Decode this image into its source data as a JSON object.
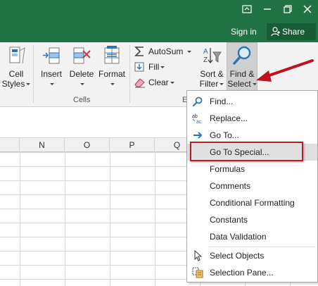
{
  "tabbar": {
    "signin": "Sign in",
    "share": "Share"
  },
  "ribbon": {
    "cell_styles": "Cell\nStyles",
    "insert": "Insert",
    "delete": "Delete",
    "format": "Format",
    "cells_group": "Cells",
    "autosum": "AutoSum",
    "fill": "Fill",
    "clear": "Clear",
    "editing_group_partial": "E",
    "sort_filter": "Sort &\nFilter",
    "find_select": "Find &\nSelect"
  },
  "columns": [
    "N",
    "O",
    "P",
    "Q"
  ],
  "menu": {
    "items": [
      {
        "label": "Find..."
      },
      {
        "label": "Replace..."
      },
      {
        "label": "Go To..."
      },
      {
        "label": "Go To Special..."
      },
      {
        "label": "Formulas"
      },
      {
        "label": "Comments"
      },
      {
        "label": "Conditional Formatting"
      },
      {
        "label": "Constants"
      },
      {
        "label": "Data Validation"
      },
      {
        "label": "Select Objects"
      },
      {
        "label": "Selection Pane..."
      }
    ]
  },
  "colors": {
    "brand": "#217346",
    "brand_dark": "#185c37",
    "highlight_box": "#b3202a"
  }
}
